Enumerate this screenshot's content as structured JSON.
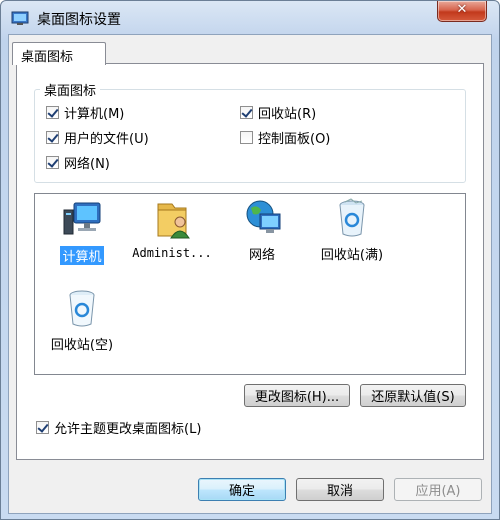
{
  "window": {
    "title": "桌面图标设置",
    "close_glyph": "✕"
  },
  "tabs": [
    {
      "label": "桌面图标"
    }
  ],
  "desktop_icons_group": {
    "title": "桌面图标",
    "checkboxes": [
      {
        "label": "计算机(M)",
        "checked": true
      },
      {
        "label": "回收站(R)",
        "checked": true
      },
      {
        "label": "用户的文件(U)",
        "checked": true
      },
      {
        "label": "控制面板(O)",
        "checked": false
      },
      {
        "label": "网络(N)",
        "checked": true
      }
    ]
  },
  "icon_list": {
    "items": [
      {
        "label": "计算机",
        "icon": "computer-icon",
        "selected": true
      },
      {
        "label": "Administ...",
        "icon": "user-folder-icon",
        "selected": false
      },
      {
        "label": "网络",
        "icon": "network-icon",
        "selected": false
      },
      {
        "label": "回收站(满)",
        "icon": "recycle-bin-full-icon",
        "selected": false
      },
      {
        "label": "回收站(空)",
        "icon": "recycle-bin-empty-icon",
        "selected": false
      }
    ]
  },
  "buttons": {
    "change_icon": "更改图标(H)...",
    "restore_default": "还原默认值(S)",
    "ok": "确定",
    "cancel": "取消",
    "apply": "应用(A)"
  },
  "allow_themes": {
    "label": "允许主题更改桌面图标(L)",
    "checked": true
  },
  "colors": {
    "selection": "#3399ff",
    "window_frame": "#c9dbf1",
    "close_button": "#c2391c"
  }
}
